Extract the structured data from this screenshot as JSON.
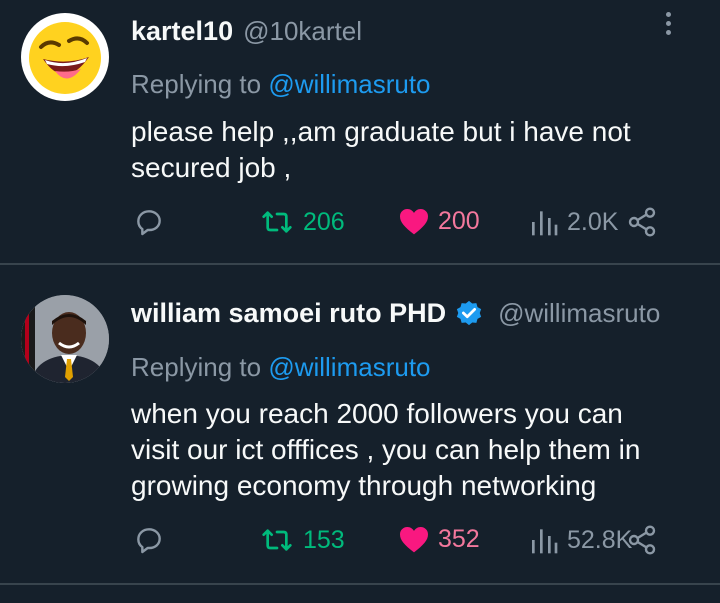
{
  "tweets": [
    {
      "name": "kartel10",
      "handle": "@10kartel",
      "replying_prefix": "Replying to ",
      "replying_to": "@willimasruto",
      "text_lines": [
        "please help ,,am graduate but i have not",
        "secured job ,"
      ],
      "retweets": "206",
      "likes": "200",
      "views": "2.0K",
      "avatar_icon": "laughing-emoji-icon"
    },
    {
      "name": "william samoei ruto PHD",
      "handle": "@willimasruto",
      "verified": true,
      "replying_prefix": "Replying to ",
      "replying_to": "@willimasruto",
      "text_lines": [
        "when you reach 2000 followers you can",
        "visit our ict offfices , you can help them in",
        "growing economy through networking"
      ],
      "retweets": "153",
      "likes": "352",
      "views": "52.8K",
      "avatar_icon": "profile-photo"
    }
  ],
  "colors": {
    "background": "#15202b",
    "text": "#f7f9f9",
    "muted": "#8b98a5",
    "link": "#1d9bf0",
    "retweet": "#00ba7c",
    "like": "#f91880",
    "divider": "#38444d"
  }
}
